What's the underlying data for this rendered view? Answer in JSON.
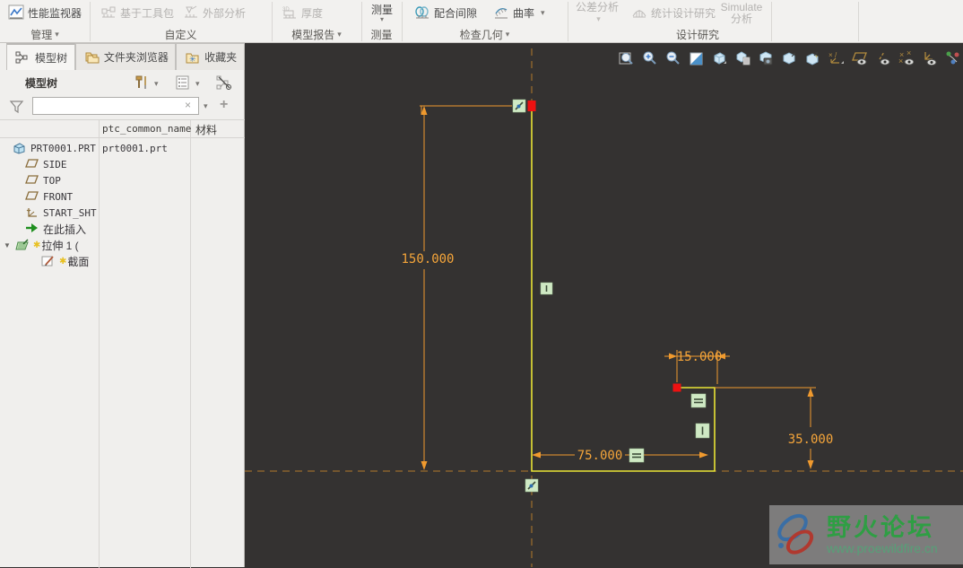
{
  "ribbon": {
    "buttons": {
      "performance_monitor": "性能监视器",
      "toolkit_based": "基于工具包",
      "external_analysis": "外部分析",
      "thickness": "厚度",
      "measure": "测量",
      "fit_clearance": "配合间隙",
      "curvature": "曲率",
      "tolerance_analysis": "公差分析",
      "statistical_design_study": "统计设计研究",
      "simulate_line1": "Simulate",
      "simulate_line2": "分析"
    },
    "group_labels": {
      "manage": "管理",
      "customize": "自定义",
      "model_report": "模型报告",
      "measure": "测量",
      "check_geometry": "检查几何",
      "design_study": "设计研究"
    }
  },
  "panel": {
    "tabs": {
      "model_tree": "模型树",
      "folder_browser": "文件夹浏览器",
      "favorites": "收藏夹"
    },
    "header_title": "模型树",
    "search_value": "",
    "columns": {
      "col1": "ptc_common_name",
      "col2": "材料"
    },
    "tree": [
      {
        "label": "PRT0001.PRT",
        "common_name": "prt0001.prt",
        "icon": "part"
      },
      {
        "label": "SIDE",
        "icon": "datum-plane"
      },
      {
        "label": "TOP",
        "icon": "datum-plane"
      },
      {
        "label": "FRONT",
        "icon": "datum-plane"
      },
      {
        "label": "START_SHT",
        "icon": "coordinate-system"
      },
      {
        "label": "在此插入",
        "icon": "insert-here-arrow"
      },
      {
        "label": "拉伸 1 (",
        "icon": "extrude-feature",
        "modified": true,
        "expanded": true
      },
      {
        "label": "截面",
        "icon": "sketch-section",
        "modified": true
      }
    ]
  },
  "canvas_toolbar_icons": [
    "zoom-refit",
    "zoom-in",
    "zoom-out",
    "repaint",
    "shading-display",
    "display-style",
    "saved-view-list",
    "view-normal",
    "view-manager",
    "datum-display-filters",
    "plane-display",
    "axis-display",
    "point-display",
    "csys-display",
    "spin-center"
  ],
  "sketch": {
    "dim_height": "150.000",
    "dim_top_width": "15.000",
    "dim_bottom_width": "75.000",
    "dim_right_height": "35.000"
  },
  "watermark": {
    "title": "野火论坛",
    "url": "www.proewildfire.cn"
  },
  "colors": {
    "sketch_line": "#e9e435",
    "dimension": "#f09a2e",
    "centerline": "#b5792b",
    "vertex": "#ee1111",
    "constraint_bg": "#cfe9c4",
    "canvas_bg": "#343231"
  }
}
